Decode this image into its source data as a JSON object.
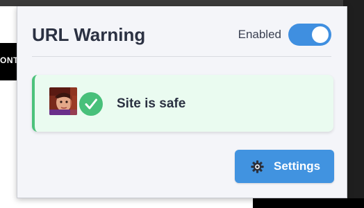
{
  "background": {
    "left_band_text": "ONT"
  },
  "popup": {
    "title": "URL Warning",
    "toggle": {
      "label": "Enabled",
      "state": "on",
      "on_color": "#3f8fe0"
    },
    "status": {
      "text": "Site is safe",
      "state": "safe",
      "accent_color": "#4cc27b",
      "icon": "check-circle-icon"
    },
    "settings_button": {
      "label": "Settings",
      "icon": "gear-icon",
      "color": "#4193e0"
    }
  }
}
